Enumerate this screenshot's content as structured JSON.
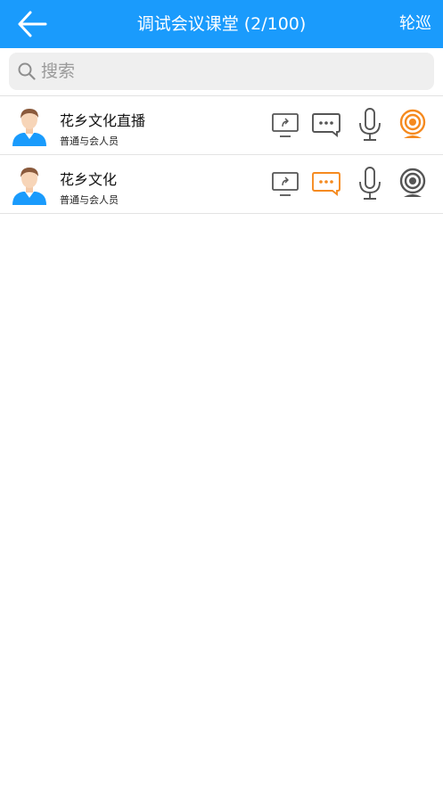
{
  "header": {
    "title": "调试会议课堂 (2/100)",
    "right_label": "轮巡"
  },
  "search": {
    "placeholder": "搜索"
  },
  "colors": {
    "header_bg": "#1a9bfc",
    "active": "#f58a1f",
    "inactive": "#555555"
  },
  "participants": [
    {
      "name": "花乡文化直播",
      "role": "普通与会人员",
      "screen_share": "inactive",
      "chat": "inactive",
      "mic": "inactive",
      "camera": "active"
    },
    {
      "name": "花乡文化",
      "role": "普通与会人员",
      "screen_share": "inactive",
      "chat": "active",
      "mic": "inactive",
      "camera": "inactive"
    }
  ]
}
